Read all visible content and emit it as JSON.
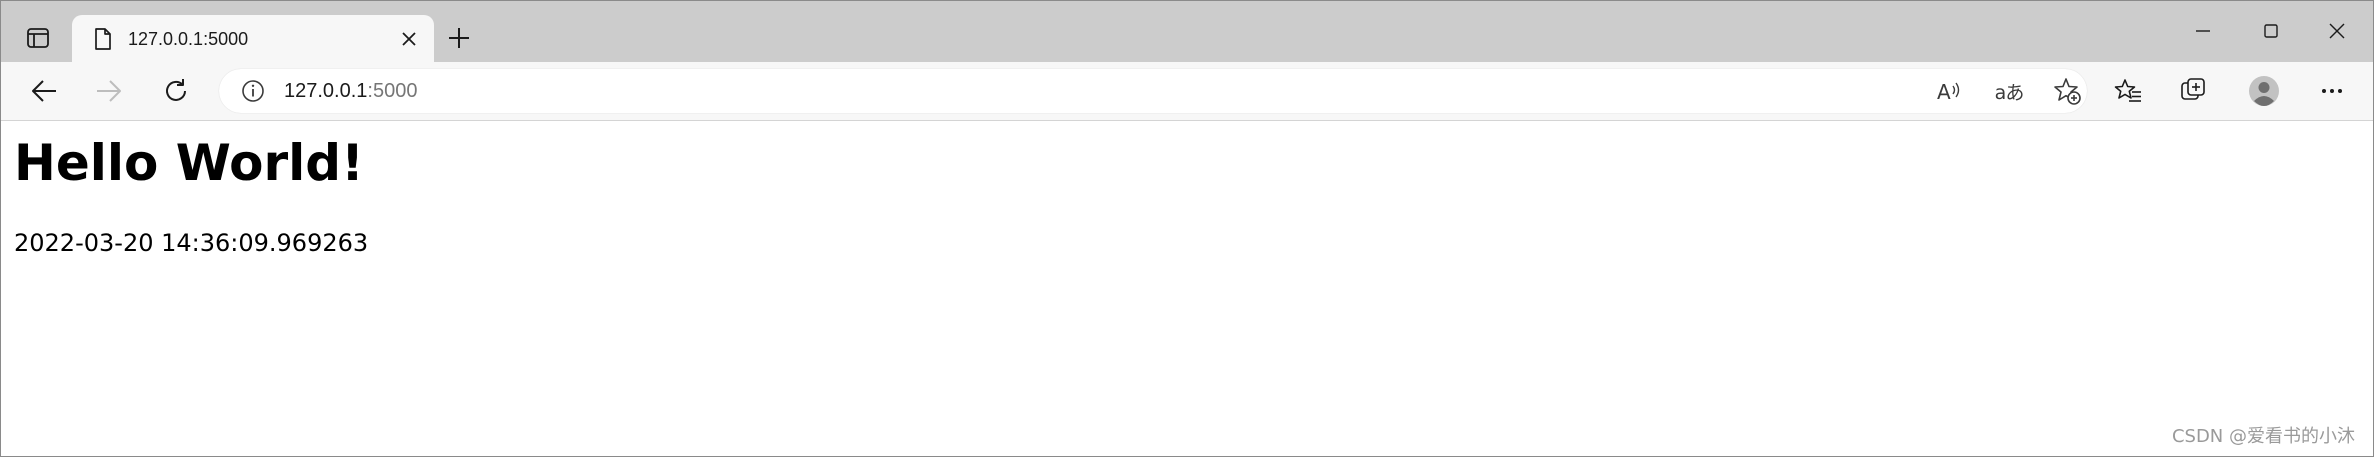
{
  "browser": {
    "tab": {
      "title": "127.0.0.1:5000",
      "icon": "page-icon"
    },
    "address_bar": {
      "host": "127.0.0.1",
      "port": ":5000",
      "info_icon": "info-icon"
    },
    "toolbar_icons": [
      "back-icon",
      "forward-icon",
      "refresh-icon",
      "read-aloud-icon",
      "translate-icon",
      "add-favorite-icon",
      "favorites-icon",
      "collections-icon",
      "profile-icon",
      "more-icon"
    ],
    "translate_glyph": "aあ",
    "window_controls": [
      "minimize-icon",
      "maximize-icon",
      "close-icon"
    ]
  },
  "page": {
    "heading": "Hello World!",
    "timestamp": "2022-03-20 14:36:09.969263"
  },
  "watermark": "CSDN @爱看书的小沐"
}
